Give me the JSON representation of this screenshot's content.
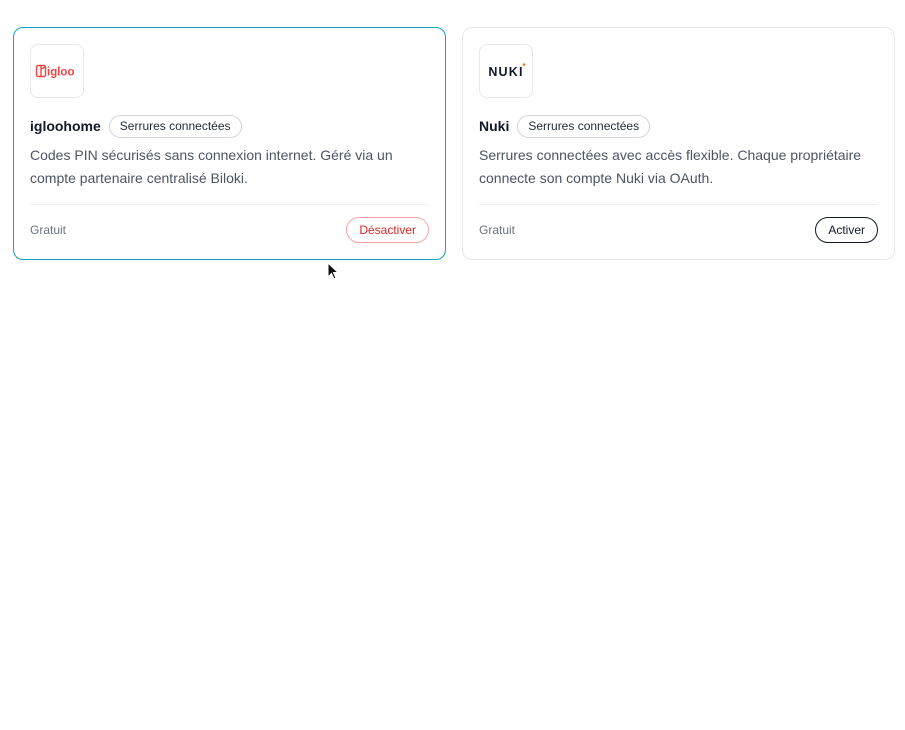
{
  "integrations": [
    {
      "id": "igloohome",
      "logo_text": "igloo",
      "name": "igloohome",
      "category": "Serrures connectées",
      "description": "Codes PIN sécurisés sans connexion internet. Géré via un compte partenaire centralisé Biloki.",
      "price": "Gratuit",
      "action_label": "Désactiver",
      "active": true
    },
    {
      "id": "nuki",
      "logo_text": "NUKI",
      "name": "Nuki",
      "category": "Serrures connectées",
      "description": "Serrures connectées avec accès flexible. Chaque propriétaire connecte son compte Nuki via OAuth.",
      "price": "Gratuit",
      "action_label": "Activer",
      "active": false
    }
  ],
  "colors": {
    "accent_border": "#0ea5c6",
    "igloo_brand": "#ef4444",
    "nuki_dot": "#f97316",
    "deactivate": "#dc2626"
  }
}
